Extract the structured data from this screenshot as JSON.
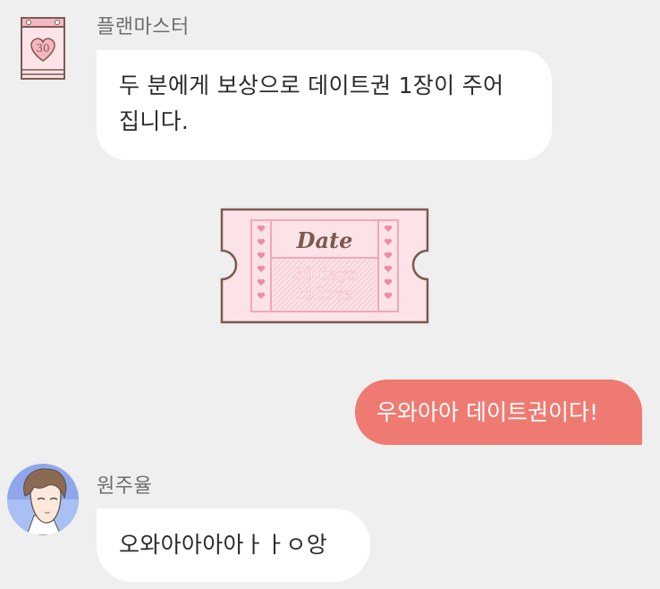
{
  "messages": [
    {
      "sender": "플랜마스터",
      "text": "두 분에게 보상으로 데이트권 1장이 주어\n집니다.",
      "avatar_icon": "calendar-30-icon"
    },
    {
      "ticket": {
        "title": "Date",
        "subtitle_line1": "30 days",
        "subtitle_line2": "to love"
      }
    },
    {
      "sender": "me",
      "text": "우와아아 데이트권이다!"
    },
    {
      "sender": "원주율",
      "text": "오와아아아아ㅏㅏㅇ앙",
      "avatar_icon": "user-avatar-icon"
    }
  ],
  "colors": {
    "background": "#efefef",
    "incoming_bubble": "#ffffff",
    "outgoing_bubble": "#ef7a71",
    "ticket_fill": "#fbe3e8",
    "ticket_border": "#7b5b50",
    "ticket_accent": "#f2a7b5"
  },
  "calendar_badge": "30"
}
